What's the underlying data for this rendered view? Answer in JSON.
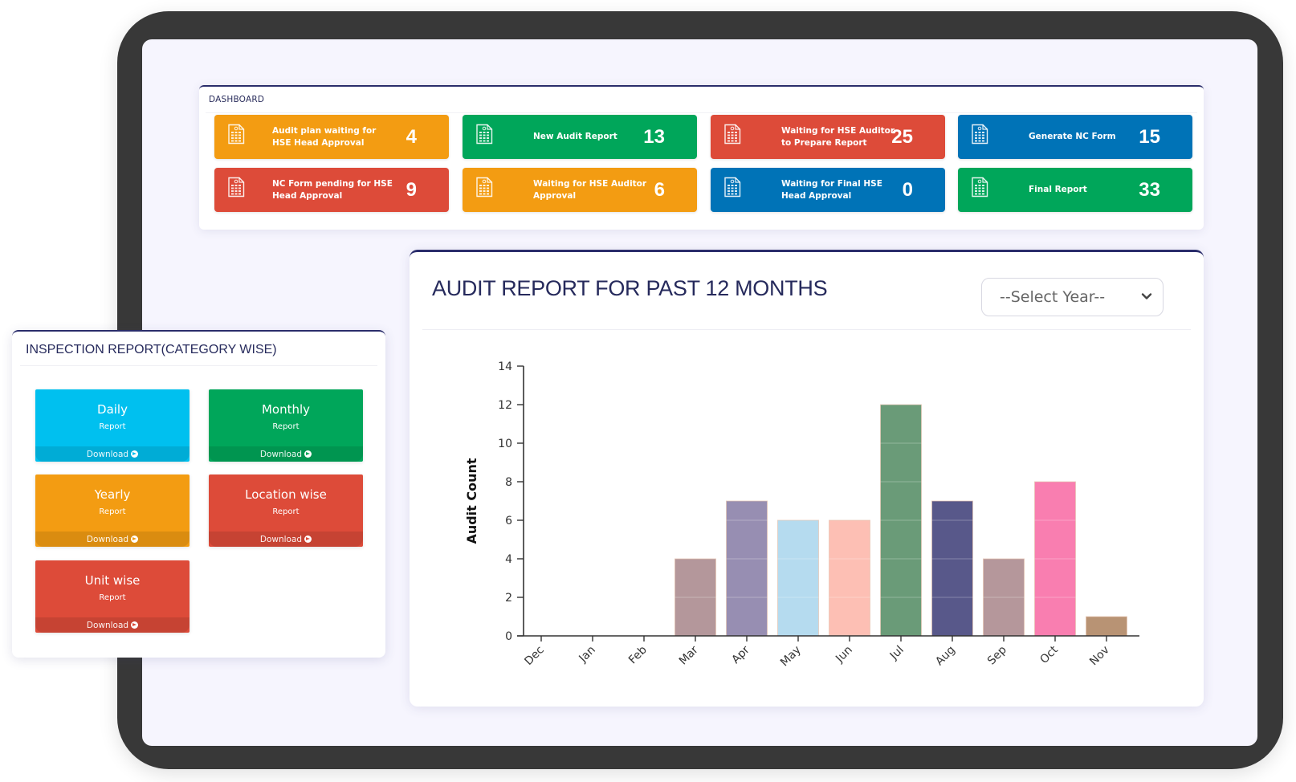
{
  "dashboard": {
    "title": "DASHBOARD",
    "cards": [
      {
        "label": "Audit plan waiting for HSE Head Approval",
        "value": "4",
        "color": "#f39c12",
        "icon": "document-icon"
      },
      {
        "label": "New Audit Report",
        "value": "13",
        "color": "#00a65a",
        "icon": "document-icon"
      },
      {
        "label": "Waiting for HSE Auditor to Prepare Report",
        "value": "25",
        "color": "#dd4b39",
        "icon": "document-icon"
      },
      {
        "label": "Generate NC Form",
        "value": "15",
        "color": "#0073b7",
        "icon": "document-icon"
      },
      {
        "label": "NC Form pending for HSE Head Approval",
        "value": "9",
        "color": "#dd4b39",
        "icon": "document-icon"
      },
      {
        "label": "Waiting for HSE Auditor Approval",
        "value": "6",
        "color": "#f39c12",
        "icon": "document-icon"
      },
      {
        "label": "Waiting for Final HSE Head Approval",
        "value": "0",
        "color": "#0073b7",
        "icon": "document-icon"
      },
      {
        "label": "Final Report",
        "value": "33",
        "color": "#00a65a",
        "icon": "document-icon"
      }
    ]
  },
  "audit_chart_panel": {
    "title": "AUDIT REPORT FOR PAST 12 MONTHS",
    "year_select": {
      "selected": "--Select Year--",
      "icon": "chevron-down-icon"
    }
  },
  "chart_data": {
    "type": "bar",
    "title": "AUDIT REPORT FOR PAST 12 MONTHS",
    "xlabel": "",
    "ylabel": "Audit Count",
    "categories": [
      "Dec",
      "Jan",
      "Feb",
      "Mar",
      "Apr",
      "May",
      "Jun",
      "Jul",
      "Aug",
      "Sep",
      "Oct",
      "Nov"
    ],
    "values": [
      0,
      0,
      0,
      4,
      7,
      6,
      6,
      12,
      7,
      4,
      8,
      1
    ],
    "colors": [
      "#b5979b",
      "#9a90b3",
      "#b4dbef",
      "#b4979b",
      "#978eb2",
      "#b5dbef",
      "#fdbfb4",
      "#6a9b78",
      "#58588a",
      "#b5979b",
      "#f97eb0",
      "#b89374"
    ],
    "ylim": [
      0,
      14
    ],
    "yticks": [
      0,
      2,
      4,
      6,
      8,
      10,
      12,
      14
    ],
    "grid": false,
    "legend": "none"
  },
  "inspection": {
    "title": "INSPECTION REPORT(CATEGORY WISE)",
    "cards": [
      {
        "name": "Daily",
        "sub": "Report",
        "download": "Download",
        "color": "#00c0ef"
      },
      {
        "name": "Monthly",
        "sub": "Report",
        "download": "Download",
        "color": "#00a65a"
      },
      {
        "name": "Yearly",
        "sub": "Report",
        "download": "Download",
        "color": "#f39c12"
      },
      {
        "name": "Location wise",
        "sub": "Report",
        "download": "Download",
        "color": "#dd4b39"
      },
      {
        "name": "Unit wise",
        "sub": "Report",
        "download": "Download",
        "color": "#dd4b39"
      }
    ]
  }
}
